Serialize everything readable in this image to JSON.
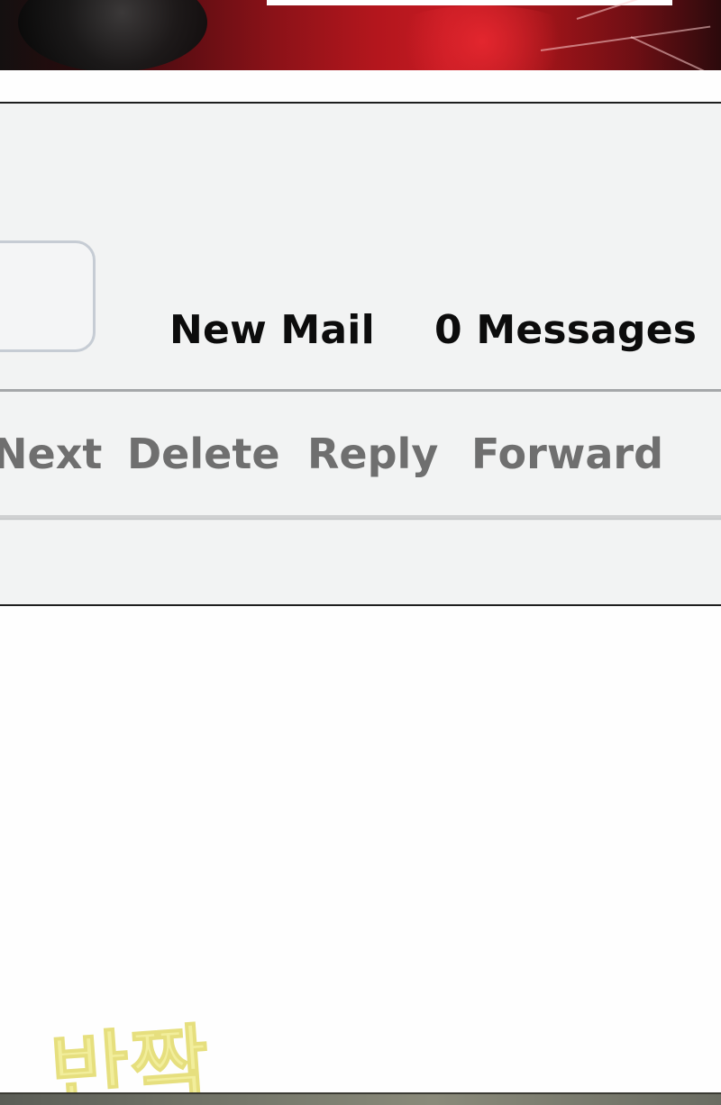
{
  "mail_header": {
    "new_mail_label": "New Mail",
    "message_count": "0 Messages"
  },
  "toolbar": {
    "next_label": "Next",
    "delete_label": "Delete",
    "reply_label": "Reply",
    "forward_label": "Forward"
  },
  "sound_effect": {
    "text": "반짝"
  },
  "colors": {
    "panel_background": "#f2f3f3",
    "header_text": "#0c0c0c",
    "toolbar_text": "#6f6f6f",
    "sfx_text": "#f2ee9c",
    "art_accent": "#c31a22"
  }
}
